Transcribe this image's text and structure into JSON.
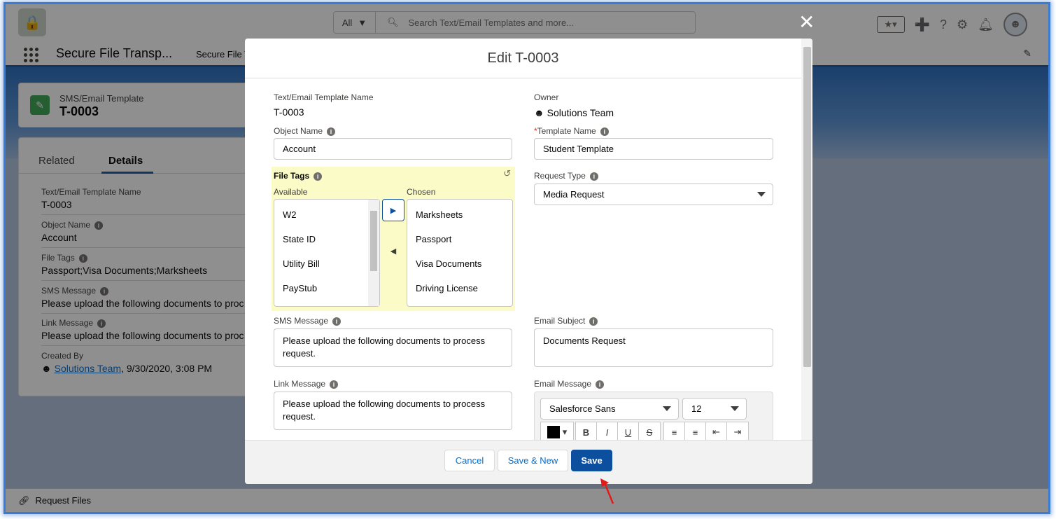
{
  "header": {
    "search_scope": "All",
    "search_placeholder": "Search Text/Email Templates and more...",
    "app_name": "Secure File Transp...",
    "nav_tab": "Secure File T"
  },
  "record": {
    "type": "SMS/Email Template",
    "name": "T-0003",
    "tabs": [
      "Related",
      "Details"
    ],
    "fields": [
      {
        "label": "Text/Email Template Name",
        "value": "T-0003"
      },
      {
        "label": "Object Name",
        "value": "Account"
      },
      {
        "label": "File Tags",
        "value": "Passport;Visa Documents;Marksheets"
      },
      {
        "label": "SMS Message",
        "value": "Please upload the following documents to proc"
      },
      {
        "label": "Link Message",
        "value": "Please upload the following documents to proc"
      },
      {
        "label": "Created By",
        "value": ", 9/30/2020, 3:08 PM",
        "user": "Solutions Team"
      }
    ]
  },
  "modal": {
    "title": "Edit T-0003",
    "template_name_label": "Text/Email Template Name",
    "template_name_value": "T-0003",
    "owner_label": "Owner",
    "owner_value": "Solutions Team",
    "object_name_label": "Object Name",
    "object_name_value": "Account",
    "template_name_field_label": "Template Name",
    "template_name_field_value": "Student Template",
    "required_marker": "*",
    "file_tags_label": "File Tags",
    "available_label": "Available",
    "chosen_label": "Chosen",
    "available": [
      "W2",
      "State ID",
      "Utility Bill",
      "PayStub"
    ],
    "chosen": [
      "Marksheets",
      "Passport",
      "Visa Documents",
      "Driving License"
    ],
    "request_type_label": "Request Type",
    "request_type_value": "Media Request",
    "sms_label": "SMS Message",
    "sms_value": "Please upload the following documents to process request.",
    "email_subject_label": "Email Subject",
    "email_subject_value": "Documents Request",
    "link_label": "Link Message",
    "link_value": "Please upload the following documents to process request.",
    "email_message_label": "Email Message",
    "font_value": "Salesforce Sans",
    "size_value": "12",
    "buttons": {
      "cancel": "Cancel",
      "save_new": "Save & New",
      "save": "Save"
    }
  },
  "footer": {
    "utility_item": "Request Files"
  },
  "colors": {
    "brand": "#0b4f9e",
    "highlight": "#fbfbc8",
    "annotation": "#e31b1b"
  }
}
